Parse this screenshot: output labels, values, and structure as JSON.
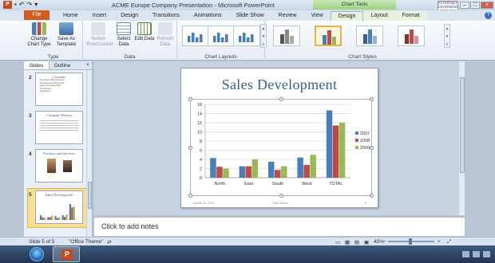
{
  "window": {
    "title": "ACME Europe Company Presentation - Microsoft PowerPoint",
    "context_tab_header": "Chart Tools",
    "watermark": "INTERNET LEARNING SERVICE"
  },
  "tabs": [
    {
      "label": "File"
    },
    {
      "label": "Home"
    },
    {
      "label": "Insert"
    },
    {
      "label": "Design"
    },
    {
      "label": "Transitions"
    },
    {
      "label": "Animations"
    },
    {
      "label": "Slide Show"
    },
    {
      "label": "Review"
    },
    {
      "label": "View"
    },
    {
      "label": "Design"
    },
    {
      "label": "Layout"
    },
    {
      "label": "Format"
    }
  ],
  "ribbon": {
    "type_group": {
      "label": "Type",
      "change_chart_type": "Change Chart Type",
      "save_as_template": "Save As Template"
    },
    "data_group": {
      "label": "Data",
      "switch_row_column": "Switch Row/Column",
      "select_data": "Select Data",
      "edit_data": "Edit Data",
      "refresh_data": "Refresh Data"
    },
    "chart_layouts_label": "Chart Layouts",
    "chart_styles_label": "Chart Styles"
  },
  "left_pane": {
    "tabs": [
      "Slides",
      "Outline"
    ],
    "slides": [
      {
        "number": "2",
        "title": "Contents",
        "bullets": [
          "Company Brief & Facts",
          "Products and Services",
          "Sales Development",
          "Conclusion",
          "Questions"
        ]
      },
      {
        "number": "3",
        "title": "Company History",
        "bullets": []
      },
      {
        "number": "4",
        "title": "Products and Services",
        "bullets": []
      },
      {
        "number": "5",
        "title": "Sales Development",
        "bullets": []
      }
    ]
  },
  "slide": {
    "title": "Sales Development",
    "footer_left": "October 15, 2010",
    "footer_center": "Paul Nelson",
    "footer_right": "5"
  },
  "chart_data": {
    "type": "bar",
    "categories": [
      "North",
      "East",
      "South",
      "West",
      "TOTAL"
    ],
    "series": [
      {
        "name": "2007",
        "values": [
          4.3,
          2.5,
          3.5,
          4.4,
          14.7
        ],
        "color": "#4a7ebb"
      },
      {
        "name": "2008",
        "values": [
          2.4,
          2.5,
          1.7,
          2.8,
          11.4
        ],
        "color": "#be4b48"
      },
      {
        "name": "2009",
        "values": [
          2.0,
          4.0,
          2.5,
          5.0,
          12.0
        ],
        "color": "#98b954"
      }
    ],
    "ylim": [
      0,
      16
    ],
    "yticks": [
      "0",
      "2",
      "4",
      "6",
      "8",
      "10",
      "12",
      "14",
      "16"
    ],
    "grid": true,
    "legend": "right"
  },
  "notes": {
    "placeholder": "Click to add notes"
  },
  "status": {
    "slide_of": "Slide 5 of 5",
    "theme": "\"Office Theme\"",
    "zoom": "45%"
  }
}
